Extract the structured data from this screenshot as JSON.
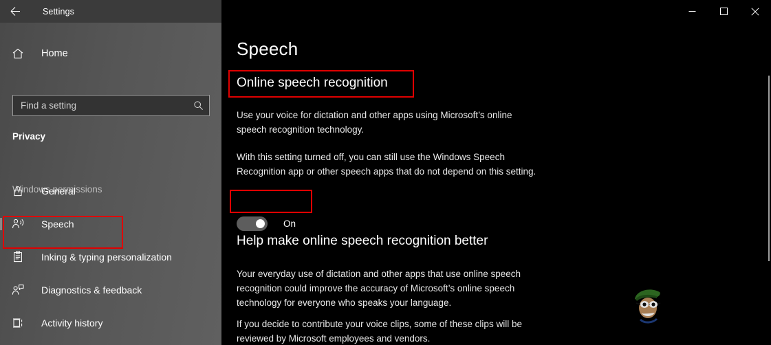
{
  "window": {
    "app_title": "Settings",
    "back_icon": "back-arrow-icon",
    "controls": {
      "minimize": "─",
      "maximize": "☐",
      "close": "✕"
    }
  },
  "sidebar": {
    "home": {
      "label": "Home",
      "icon": "home-icon"
    },
    "search": {
      "placeholder": "Find a setting",
      "value": "",
      "icon": "search-icon"
    },
    "category": "Privacy",
    "group_heading": "Windows permissions",
    "items": [
      {
        "label": "General",
        "icon": "lock-icon",
        "selected": false
      },
      {
        "label": "Speech",
        "icon": "speech-person-icon",
        "selected": true
      },
      {
        "label": "Inking & typing personalization",
        "icon": "clipboard-pen-icon",
        "selected": false
      },
      {
        "label": "Diagnostics & feedback",
        "icon": "person-feedback-icon",
        "selected": false
      },
      {
        "label": "Activity history",
        "icon": "activity-history-icon",
        "selected": false
      }
    ]
  },
  "content": {
    "page_title": "Speech",
    "section1": {
      "heading": "Online speech recognition",
      "paragraph1": "Use your voice for dictation and other apps using Microsoft’s online speech recognition technology.",
      "paragraph2": "With this setting turned off, you can still use the Windows Speech Recognition app or other speech apps that do not depend on this setting.",
      "toggle": {
        "state_label": "On",
        "checked": true
      }
    },
    "section2": {
      "heading": "Help make online speech recognition better",
      "paragraph1": "Your everyday use of dictation and other apps that use online speech recognition could improve the accuracy of Microsoft’s online speech technology for everyone who speaks your language.",
      "paragraph2": "If you decide to contribute your voice clips, some of these clips will be reviewed by Microsoft employees and vendors."
    }
  },
  "annotations": {
    "color": "#e00000",
    "boxes": [
      "speech-nav-item",
      "online-speech-recognition-heading",
      "online-speech-recognition-toggle"
    ]
  },
  "scrollbar": {
    "orientation": "vertical",
    "position": "right"
  },
  "watermark": {
    "name": "cartoon-character-watermark"
  }
}
